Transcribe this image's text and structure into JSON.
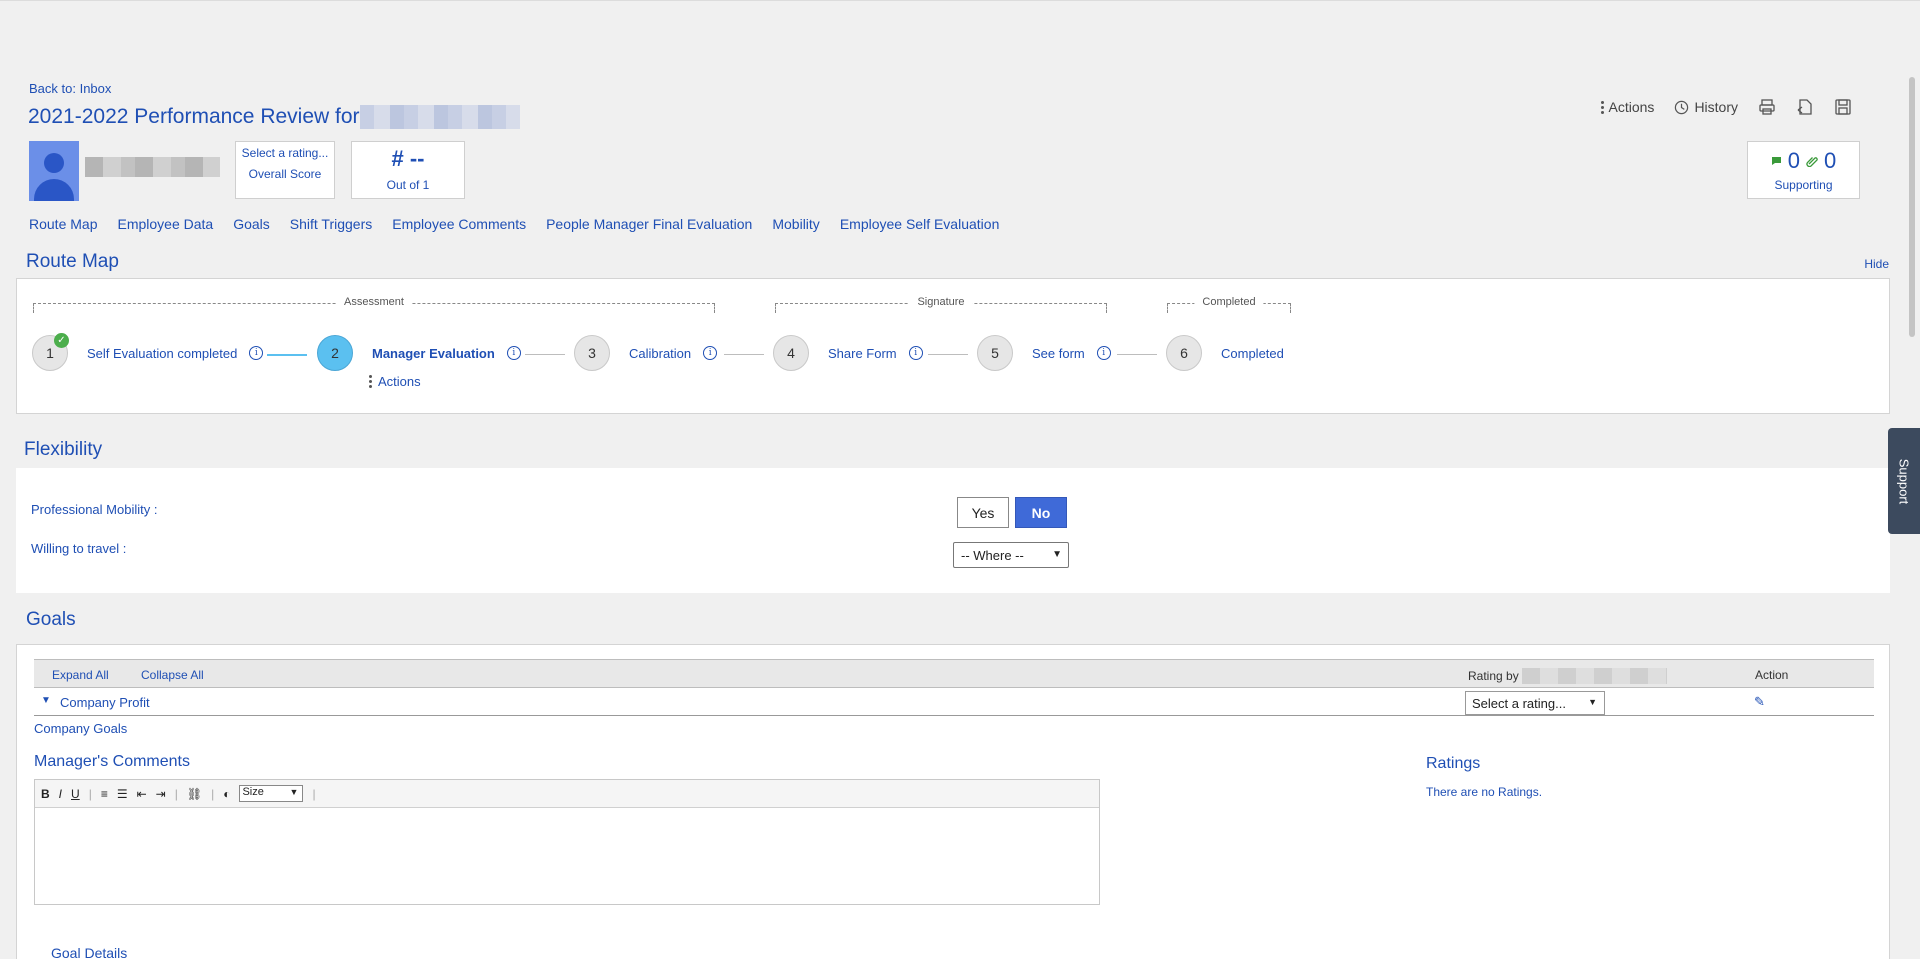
{
  "header": {
    "back_link": "Back to: Inbox",
    "title": "2021-2022 Performance Review for",
    "overall_score": {
      "select_text": "Select a rating...",
      "label": "Overall Score"
    },
    "score_box": {
      "value": "# --",
      "label": "Out of 1"
    },
    "actions": {
      "actions_label": "Actions",
      "history_label": "History"
    },
    "supporting": {
      "comments_count": "0",
      "attachments_count": "0",
      "label": "Supporting"
    }
  },
  "nav": [
    "Route Map",
    "Employee Data",
    "Goals",
    "Shift Triggers",
    "Employee Comments",
    "People Manager Final Evaluation",
    "Mobility",
    "Employee Self Evaluation"
  ],
  "route_map": {
    "title": "Route Map",
    "hide_label": "Hide",
    "groups": [
      "Assessment",
      "Signature",
      "Completed"
    ],
    "steps": [
      {
        "num": "1",
        "label": "Self Evaluation completed",
        "state": "done"
      },
      {
        "num": "2",
        "label": "Manager Evaluation",
        "state": "current"
      },
      {
        "num": "3",
        "label": "Calibration",
        "state": "pending"
      },
      {
        "num": "4",
        "label": "Share Form",
        "state": "pending"
      },
      {
        "num": "5",
        "label": "See form",
        "state": "pending"
      },
      {
        "num": "6",
        "label": "Completed",
        "state": "pending"
      }
    ],
    "step_actions": "Actions"
  },
  "flexibility": {
    "title": "Flexibility",
    "mobility_label": "Professional Mobility :",
    "yes_label": "Yes",
    "no_label": "No",
    "selected": "No",
    "travel_label": "Willing to travel :",
    "travel_value": "-- Where --"
  },
  "goals": {
    "title": "Goals",
    "expand_all": "Expand All",
    "collapse_all": "Collapse All",
    "rating_by": "Rating by",
    "action_header": "Action",
    "row_name": "Company Profit",
    "row_rating": "Select a rating...",
    "group_label": "Company Goals",
    "comments_title": "Manager's Comments",
    "editor_size": "Size",
    "ratings_title": "Ratings",
    "ratings_empty": "There are no Ratings.",
    "goal_details": "Goal Details"
  },
  "support_tab": "Support",
  "colors": {
    "accent": "#1f4fb4",
    "active_step": "#5bc0f0",
    "selected_button": "#3f6ad8"
  }
}
